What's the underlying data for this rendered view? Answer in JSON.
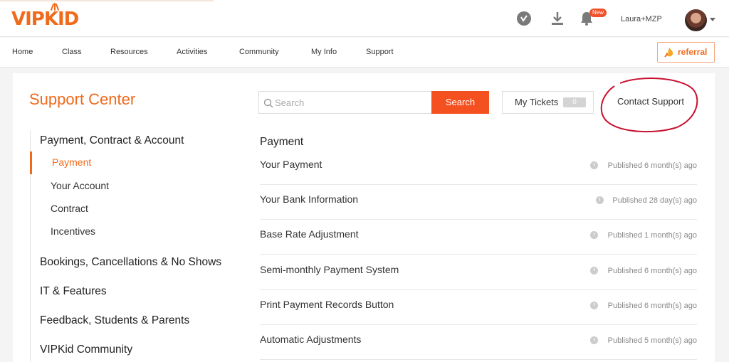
{
  "header": {
    "logo_text": "VIPKID",
    "notification_badge": "New",
    "username": "Laura+MZP",
    "icons": [
      "vip-badge-icon",
      "download-icon",
      "bell-icon",
      "avatar",
      "chevron-down-icon"
    ]
  },
  "nav": {
    "items": [
      {
        "label": "Home"
      },
      {
        "label": "Class"
      },
      {
        "label": "Resources"
      },
      {
        "label": "Activities"
      },
      {
        "label": "Community"
      },
      {
        "label": "My Info"
      },
      {
        "label": "Support"
      }
    ],
    "referral_label": "referral"
  },
  "support": {
    "title": "Support Center",
    "search_placeholder": "Search",
    "search_button": "Search",
    "my_tickets_label": "My Tickets",
    "my_tickets_count": "0",
    "contact_support_label": "Contact Support"
  },
  "sidebar": {
    "categories": [
      {
        "label": "Payment, Contract & Account",
        "subitems": [
          "Payment",
          "Your Account",
          "Contract",
          "Incentives"
        ],
        "active_subitem": "Payment"
      },
      {
        "label": "Bookings, Cancellations & No Shows"
      },
      {
        "label": "IT & Features"
      },
      {
        "label": "Feedback, Students & Parents"
      },
      {
        "label": "VIPKid Community"
      }
    ]
  },
  "articles": {
    "section_title": "Payment",
    "items": [
      {
        "title": "Your Payment",
        "meta": "Published 6 month(s) ago"
      },
      {
        "title": "Your Bank Information",
        "meta": "Published 28 day(s) ago"
      },
      {
        "title": "Base Rate Adjustment",
        "meta": "Published 1 month(s) ago"
      },
      {
        "title": "Semi-monthly Payment System",
        "meta": "Published 6 month(s) ago"
      },
      {
        "title": "Print Payment Records Button",
        "meta": "Published 6 month(s) ago"
      },
      {
        "title": "Automatic Adjustments",
        "meta": "Published 5 month(s) ago"
      }
    ]
  },
  "colors": {
    "brand_orange": "#f06a1c",
    "search_button": "#f5501f",
    "annotation_circle": "#c8102e"
  }
}
